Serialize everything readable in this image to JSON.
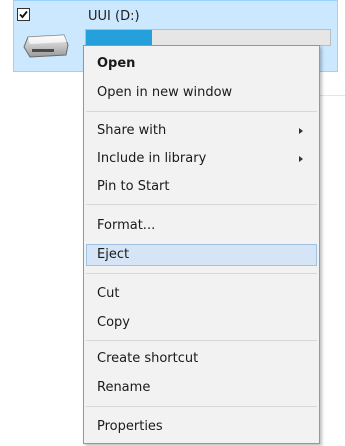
{
  "drive": {
    "label": "UUI (D:)",
    "checked": true,
    "usage_fraction": 0.27,
    "icon": "removable-drive-icon"
  },
  "context_menu": {
    "items": [
      {
        "label": "Open",
        "bold": true
      },
      {
        "label": "Open in new window"
      },
      {
        "label": "Share with",
        "submenu": true
      },
      {
        "label": "Include in library",
        "submenu": true
      },
      {
        "label": "Pin to Start"
      },
      {
        "label": "Format..."
      },
      {
        "label": "Eject",
        "highlighted": true
      },
      {
        "label": "Cut"
      },
      {
        "label": "Copy"
      },
      {
        "label": "Create shortcut"
      },
      {
        "label": "Rename"
      },
      {
        "label": "Properties"
      }
    ]
  },
  "colors": {
    "selection_bg": "#cce8ff",
    "menu_bg": "#f2f2f2",
    "menu_hover": "#d5e5f6",
    "progress_fill": "#26a0da"
  }
}
